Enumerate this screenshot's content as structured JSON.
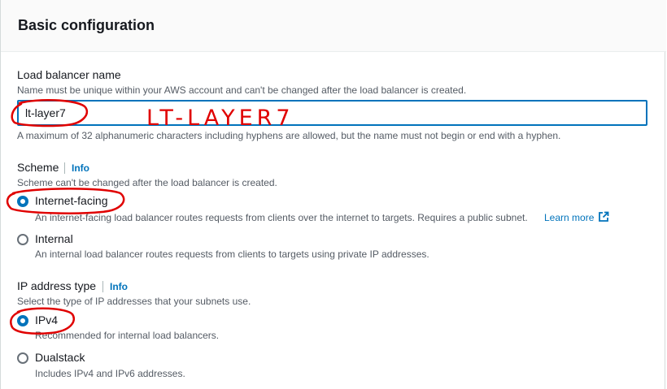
{
  "panel": {
    "title": "Basic configuration"
  },
  "lb_name": {
    "label": "Load balancer name",
    "description": "Name must be unique within your AWS account and can't be changed after the load balancer is created.",
    "value": "lt-layer7",
    "constraint": "A maximum of 32 alphanumeric characters including hyphens are allowed, but the name must not begin or end with a hyphen."
  },
  "scheme": {
    "label": "Scheme",
    "info": "Info",
    "description": "Scheme can't be changed after the load balancer is created.",
    "options": [
      {
        "label": "Internet-facing",
        "description": "An internet-facing load balancer routes requests from clients over the internet to targets. Requires a public subnet.",
        "link": "Learn more",
        "checked": true
      },
      {
        "label": "Internal",
        "description": "An internal load balancer routes requests from clients to targets using private IP addresses.",
        "checked": false
      }
    ]
  },
  "ip_type": {
    "label": "IP address type",
    "info": "Info",
    "description": "Select the type of IP addresses that your subnets use.",
    "options": [
      {
        "label": "IPv4",
        "description": "Recommended for internal load balancers.",
        "checked": true
      },
      {
        "label": "Dualstack",
        "description": "Includes IPv4 and IPv6 addresses.",
        "checked": false
      }
    ]
  },
  "annotation": {
    "text": "LT-LAYER7",
    "color": "#e00000"
  },
  "icons": {
    "external_link": "external-link-icon"
  },
  "colors": {
    "accent": "#0073bb",
    "annotation": "#e00000"
  }
}
